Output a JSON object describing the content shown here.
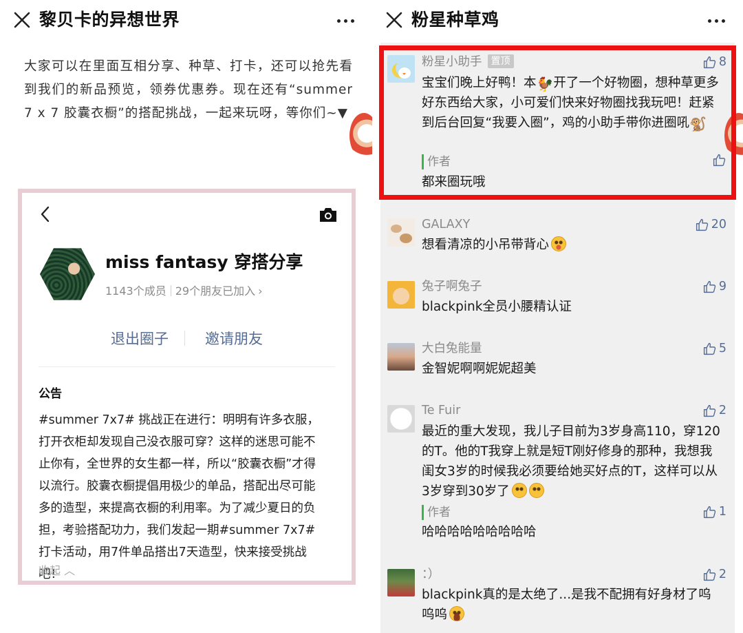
{
  "left": {
    "title": "黎贝卡的异想世界",
    "article_text": "大家可以在里面互相分享、种草、打卡，还可以抢先看到我们的新品预览，领券优惠券。现在还有“summer 7 x 7 胶囊衣橱”的搭配挑战，一起来玩呀，等你们~▼",
    "circle": {
      "name": "miss fantasy 穿搭分享",
      "members": "1143个成员",
      "friends_joined": "29个朋友已加入",
      "exit_label": "退出圈子",
      "invite_label": "邀请朋友",
      "notice_title": "公告",
      "notice_text": "#summer 7x7# 挑战正在进行：明明有许多衣服，打开衣柜却发现自己没衣服可穿？这样的迷思可能不止你有，全世界的女生都一样，所以“胶囊衣橱”才得以流行。胶囊衣橱提倡用极少的单品，搭配出尽可能多的造型，来提高衣橱的利用率。为了减少夏日的负担，考验搭配功力，我们发起一期#summer 7x7#打卡活动，用7件单品搭出7天造型，快来接受挑战吧！",
      "collapse_label": "收起"
    }
  },
  "right": {
    "title": "粉星种草鸡",
    "comments": [
      {
        "name": "粉星小助手",
        "badge": "置顶",
        "likes": "8",
        "text_part1": "宝宝们晚上好鸭！本",
        "text_part2": "开了一个好物圈，想种草更多好东西给大家，小可爱们快来好物圈找我玩吧！赶紧到后台回复“我要入圈”，鸡的小助手带你进圈吼",
        "author_label": "作者",
        "reply": "都来圈玩哦"
      },
      {
        "name": "GALAXY",
        "likes": "20",
        "text": "想看清凉的小吊带背心"
      },
      {
        "name": "兔子啊兔子",
        "likes": "9",
        "text": "blackpink全员小腰精认证"
      },
      {
        "name": "大白兔能量",
        "likes": "5",
        "text": "金智妮啊啊妮妮超美"
      },
      {
        "name": "Te Fuir",
        "likes": "2",
        "text": "最近的重大发现，我儿子目前为3岁身高110，穿120的T。他的T我穿上就是短T刚好修身的那种，我想我闺女3岁的时候我必须要给她买好点的T，这样可以从3岁穿到30岁了",
        "author_label": "作者",
        "author_likes": "1",
        "reply": "哈哈哈哈哈哈哈哈哈"
      },
      {
        "name": "：）",
        "likes": "2",
        "text": "blackpink真的是太绝了...是我不配拥有好身材了呜呜呜"
      }
    ]
  },
  "colors": {
    "highlight_border": "#ee1111",
    "frame_border": "#e9cdd4",
    "link_blue": "#556c94",
    "author_green": "#39b54a"
  },
  "icons": [
    "close-icon",
    "more-icon",
    "back-icon",
    "camera-icon",
    "thumbs-up-icon",
    "chevron-right-icon",
    "chevron-up-icon",
    "rooster-icon",
    "monkey-icon"
  ]
}
